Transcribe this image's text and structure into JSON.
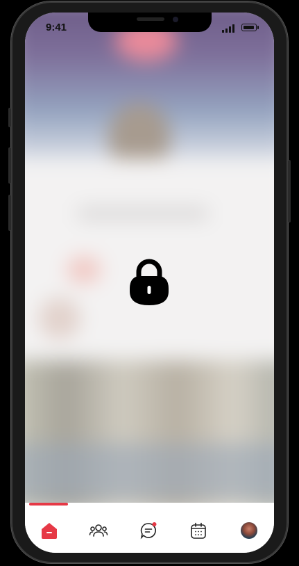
{
  "status_bar": {
    "time": "9:41"
  },
  "screen": {
    "state": "locked"
  },
  "tab_bar": {
    "items": [
      {
        "id": "home",
        "icon": "home-icon",
        "active": true
      },
      {
        "id": "people",
        "icon": "people-icon",
        "active": false
      },
      {
        "id": "chat",
        "icon": "chat-icon",
        "active": false,
        "has_notification": true
      },
      {
        "id": "calendar",
        "icon": "calendar-icon",
        "active": false
      },
      {
        "id": "profile",
        "icon": "avatar",
        "active": false
      }
    ]
  },
  "colors": {
    "accent": "#e63946",
    "lock": "#000000",
    "icon": "#222222"
  }
}
